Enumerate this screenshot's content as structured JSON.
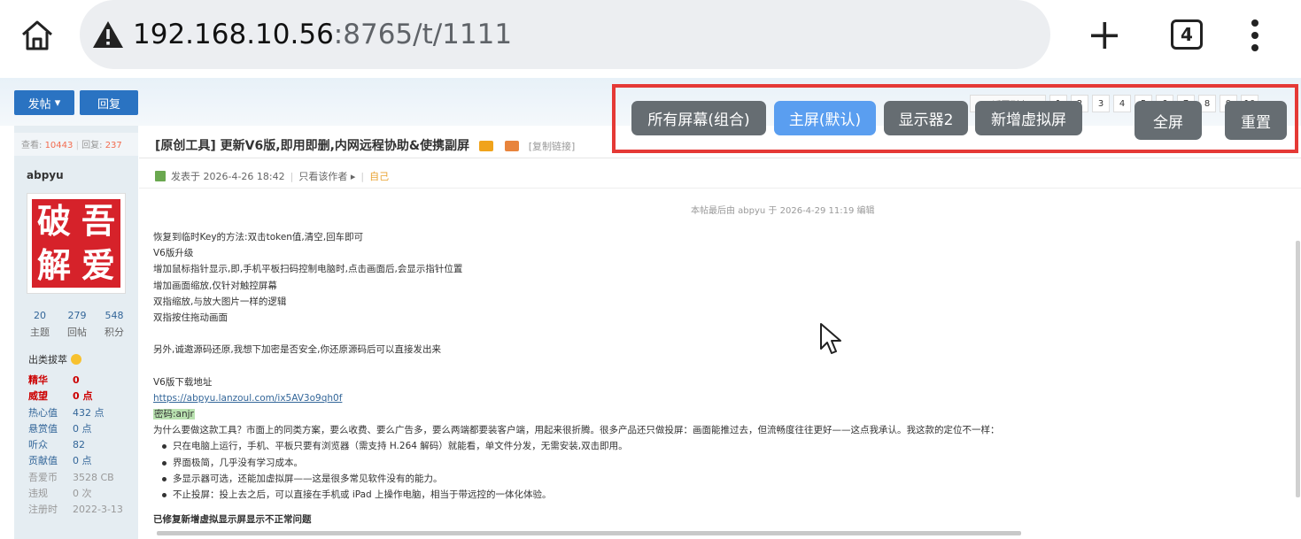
{
  "browser": {
    "url_host": "192.168.10.56",
    "url_rest": ":8765/t/1111",
    "tab_count": "4"
  },
  "toolbar": {
    "post_label": "发帖",
    "reply_label": "回复"
  },
  "pager": {
    "back_label": "返回列表",
    "pages": [
      "1",
      "2",
      "3",
      "4",
      "5",
      "6",
      "7",
      "8",
      "9",
      "10"
    ]
  },
  "sidebar": {
    "views_label": "查看:",
    "views": "10443",
    "replies_label": "回复:",
    "replies": "237",
    "username": "abpyu",
    "avatar_chars": [
      "破",
      "吾",
      "解",
      "爱"
    ],
    "counts": [
      {
        "value": "20",
        "label": "主题"
      },
      {
        "value": "279",
        "label": "回帖"
      },
      {
        "value": "548",
        "label": "积分"
      }
    ],
    "rank": "出类拔萃",
    "props": [
      {
        "key": "精华",
        "value": "0"
      },
      {
        "key": "威望",
        "value": "0 点"
      },
      {
        "key": "热心值",
        "value": "432 点"
      },
      {
        "key": "悬赏值",
        "value": "0 点"
      },
      {
        "key": "听众",
        "value": "82"
      },
      {
        "key": "贡献值",
        "value": "0 点"
      },
      {
        "key": "吾爱币",
        "value": "3528 CB"
      },
      {
        "key": "违规",
        "value": "0 次"
      },
      {
        "key": "注册时",
        "value": "2022-3-13"
      }
    ]
  },
  "post": {
    "title": "[原创工具] 更新V6版,即用即删,内网远程协助&使携副屏",
    "copy_link": "[复制链接]",
    "posted_at": "发表于 2026-4-26 18:42",
    "only_author": "只看该作者",
    "self_label": "自己",
    "edit_note": "本帖最后由 abpyu 于 2026-4-29 11:19 编辑",
    "lines": [
      "恢复到临时Key的方法:双击token值,清空,回车即可",
      "V6版升级",
      "增加鼠标指针显示,即,手机平板扫码控制电脑时,点击画面后,会显示指针位置",
      "增加画面缩放,仅针对触控屏幕",
      "双指缩放,与放大图片一样的逻辑",
      "双指按住拖动画面"
    ],
    "source_note": "另外,诚邀源码还原,我想下加密是否安全,你还原源码后可以直接发出来",
    "download_title": "V6版下载地址",
    "download_link": "https://abpyu.lanzoul.com/ix5AV3o9qh0f",
    "password": "密码:anjr",
    "why_text": "为什么要做这款工具？市面上的同类方案，要么收费、要么广告多，要么两端都要装客户端，用起来很折腾。很多产品还只做投屏：画面能推过去，但流畅度往往更好——这点我承认。我这款的定位不一样：",
    "bullets": [
      "只在电脑上运行，手机、平板只要有浏览器（需支持 H.264 解码）就能看，单文件分发，无需安装,双击即用。",
      "界面极简，几乎没有学习成本。",
      "多显示器可选，还能加虚拟屏——这是很多常见软件没有的能力。",
      "不止投屏：投上去之后，可以直接在手机或 iPad 上操作电脑，相当于带远控的一体化体验。"
    ],
    "fix_heading": "已修复新增虚拟显示屏显示不正常问题"
  },
  "overlay": {
    "all_screens": "所有屏幕(组合)",
    "main_screen": "主屏(默认)",
    "display2": "显示器2",
    "add_virtual": "新增虚拟屏",
    "fullscreen": "全屏",
    "reset": "重置"
  },
  "colors": {
    "overlay_border": "#e53935",
    "active_button": "#5a9ef0",
    "inactive_button": "#666d72"
  }
}
